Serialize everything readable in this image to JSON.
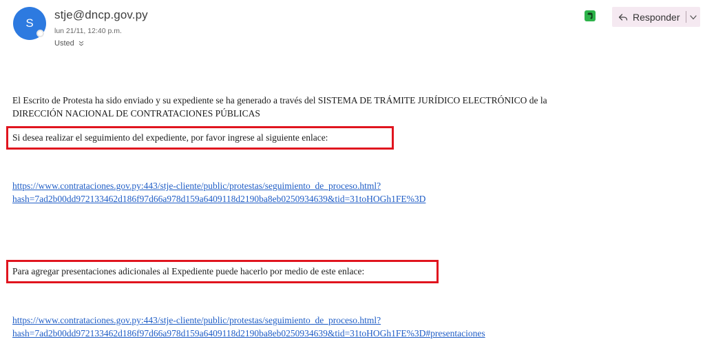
{
  "header": {
    "avatar_initial": "S",
    "sender": "stje@dncp.gov.py",
    "datetime": "lun 21/11, 12:40 p.m.",
    "recipient": "Usted",
    "reply_label": "Responder"
  },
  "body": {
    "intro_line1": "El Escrito de Protesta ha sido enviado y su expediente se ha generado a través del SISTEMA DE TRÁMITE JURÍDICO ELECTRÓNICO de la",
    "intro_line2": "DIRECCIÓN NACIONAL DE CONTRATACIONES PÚBLICAS",
    "follow_text": "Si desea realizar el seguimiento del expediente, por favor ingrese al siguiente enlace:",
    "follow_link_line1": "https://www.contrataciones.gov.py:443/stje-cliente/public/protestas/seguimiento_de_proceso.html?",
    "follow_link_line2": "hash=7ad2b00dd972133462d186f97d66a978d159a6409118d2190ba8eb0250934639&tid=31toHOGh1FE%3D",
    "additional_text": "Para agregar presentaciones adicionales al Expediente puede hacerlo por medio de este enlace:",
    "additional_link_line1": "https://www.contrataciones.gov.py:443/stje-cliente/public/protestas/seguimiento_de_proceso.html?",
    "additional_link_line2": "hash=7ad2b00dd972133462d186f97d66a978d159a6409118d2190ba8eb0250934639&tid=31toHOGh1FE%3D#presentaciones"
  },
  "colors": {
    "avatar": "#2d7ae0",
    "highlight": "#e0141e",
    "link": "#1f5dc6",
    "reply_bg": "#f5e9f1",
    "evernote": "#2db34a"
  },
  "icons": {
    "reply": "reply-arrow-icon",
    "dropdown": "chevron-down-icon",
    "expand": "double-chevron-down-icon",
    "addin": "evernote-icon"
  }
}
